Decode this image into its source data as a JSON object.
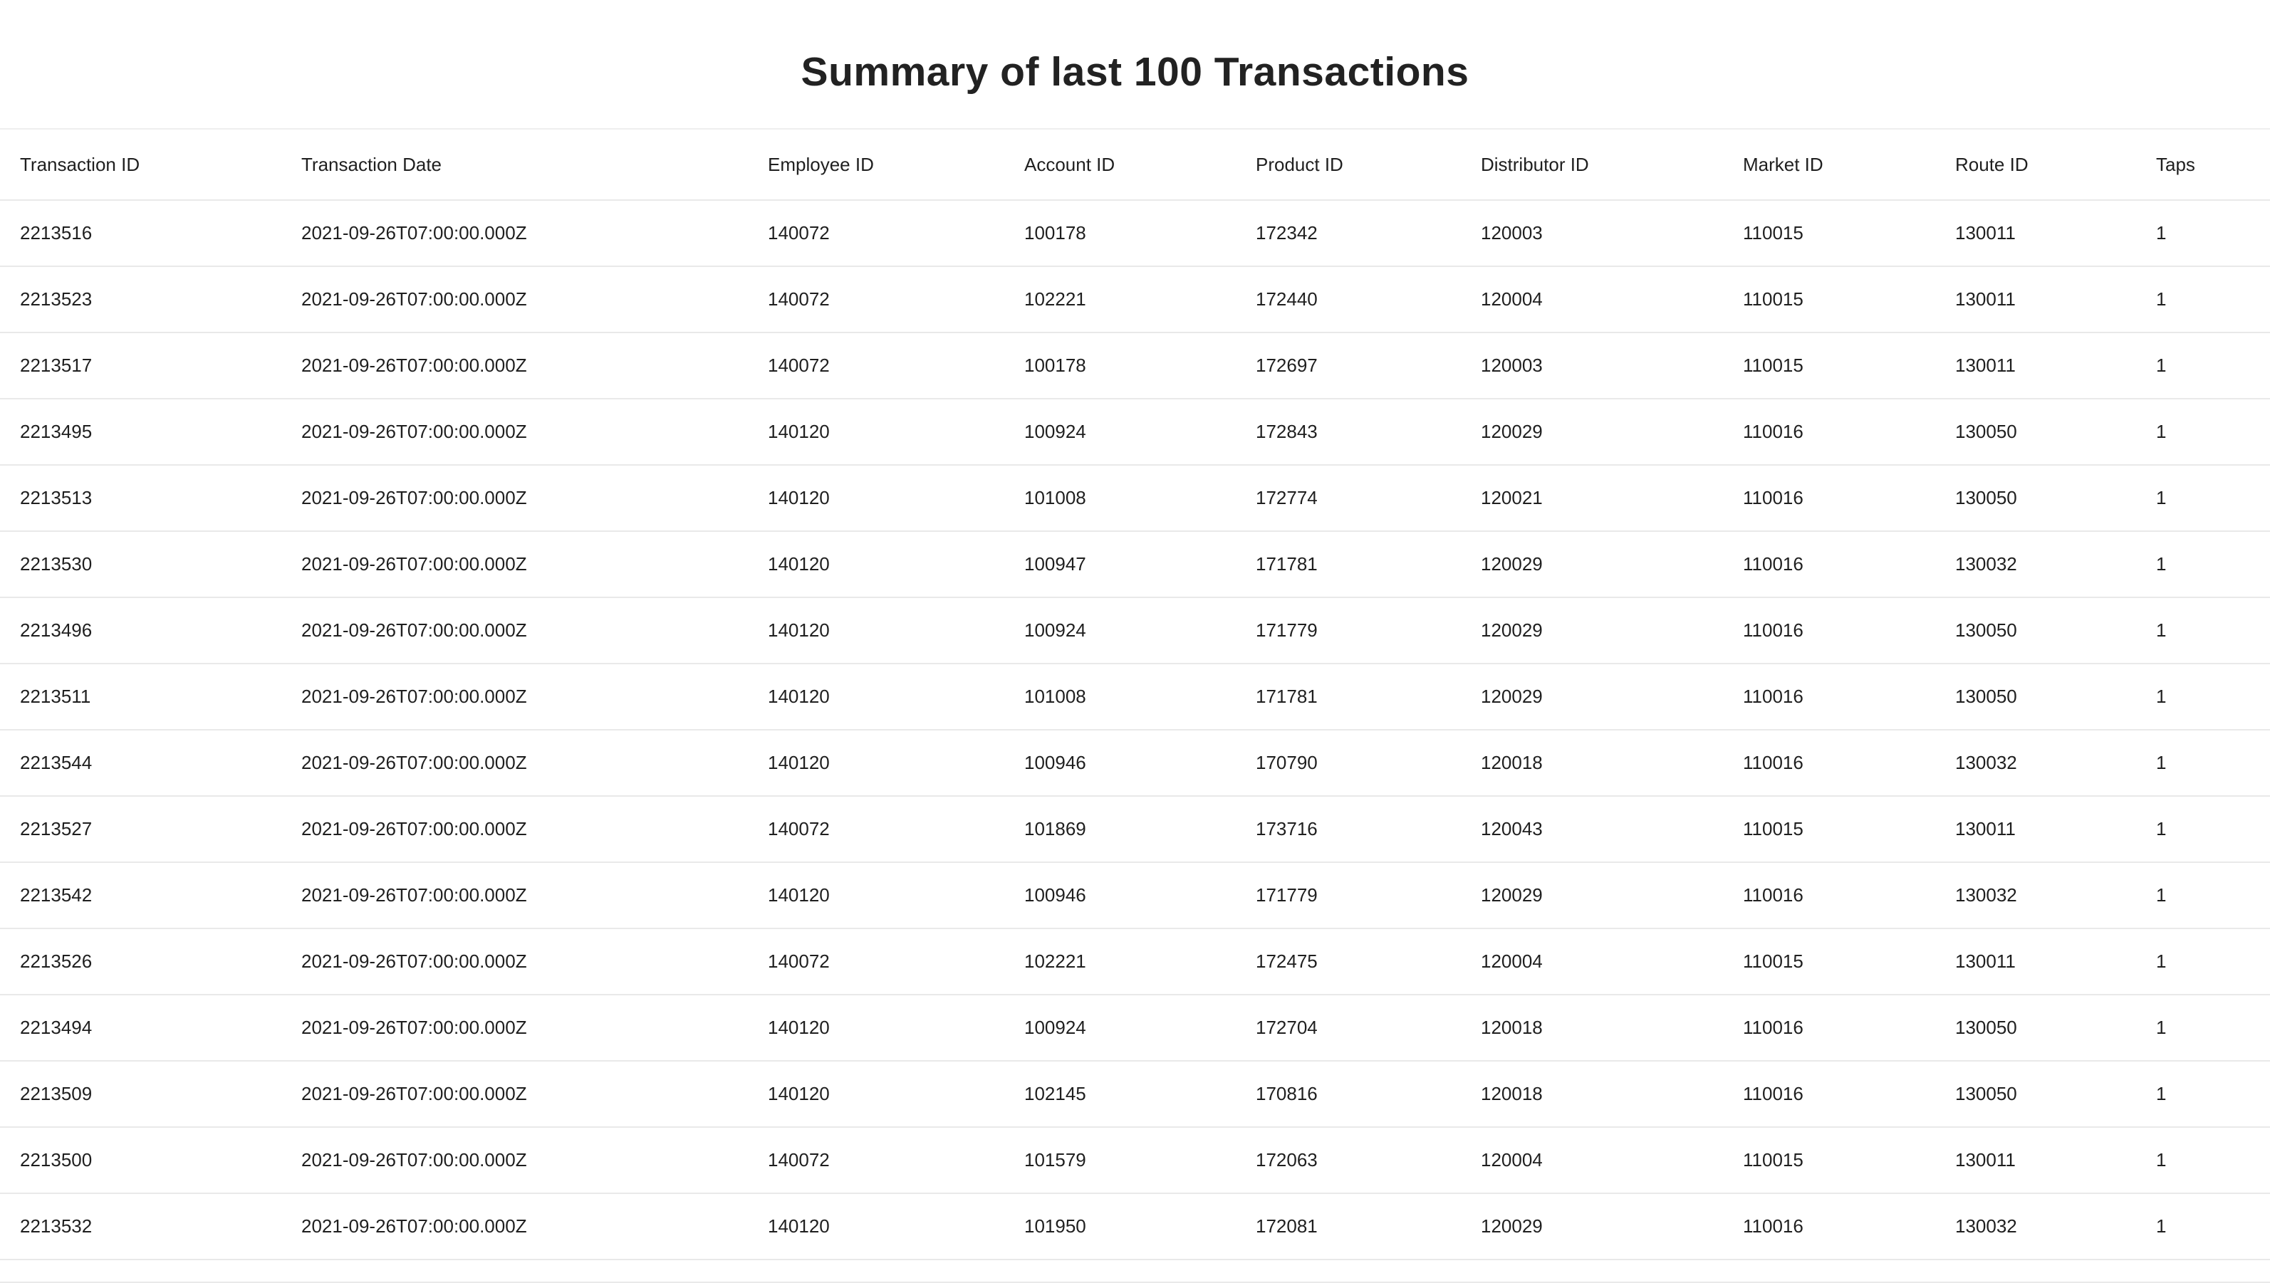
{
  "page": {
    "title": "Summary of last 100 Transactions"
  },
  "table": {
    "columns": [
      "Transaction ID",
      "Transaction Date",
      "Employee ID",
      "Account ID",
      "Product ID",
      "Distributor ID",
      "Market ID",
      "Route ID",
      "Taps"
    ],
    "rows": [
      [
        "2213516",
        "2021-09-26T07:00:00.000Z",
        "140072",
        "100178",
        "172342",
        "120003",
        "110015",
        "130011",
        "1"
      ],
      [
        "2213523",
        "2021-09-26T07:00:00.000Z",
        "140072",
        "102221",
        "172440",
        "120004",
        "110015",
        "130011",
        "1"
      ],
      [
        "2213517",
        "2021-09-26T07:00:00.000Z",
        "140072",
        "100178",
        "172697",
        "120003",
        "110015",
        "130011",
        "1"
      ],
      [
        "2213495",
        "2021-09-26T07:00:00.000Z",
        "140120",
        "100924",
        "172843",
        "120029",
        "110016",
        "130050",
        "1"
      ],
      [
        "2213513",
        "2021-09-26T07:00:00.000Z",
        "140120",
        "101008",
        "172774",
        "120021",
        "110016",
        "130050",
        "1"
      ],
      [
        "2213530",
        "2021-09-26T07:00:00.000Z",
        "140120",
        "100947",
        "171781",
        "120029",
        "110016",
        "130032",
        "1"
      ],
      [
        "2213496",
        "2021-09-26T07:00:00.000Z",
        "140120",
        "100924",
        "171779",
        "120029",
        "110016",
        "130050",
        "1"
      ],
      [
        "2213511",
        "2021-09-26T07:00:00.000Z",
        "140120",
        "101008",
        "171781",
        "120029",
        "110016",
        "130050",
        "1"
      ],
      [
        "2213544",
        "2021-09-26T07:00:00.000Z",
        "140120",
        "100946",
        "170790",
        "120018",
        "110016",
        "130032",
        "1"
      ],
      [
        "2213527",
        "2021-09-26T07:00:00.000Z",
        "140072",
        "101869",
        "173716",
        "120043",
        "110015",
        "130011",
        "1"
      ],
      [
        "2213542",
        "2021-09-26T07:00:00.000Z",
        "140120",
        "100946",
        "171779",
        "120029",
        "110016",
        "130032",
        "1"
      ],
      [
        "2213526",
        "2021-09-26T07:00:00.000Z",
        "140072",
        "102221",
        "172475",
        "120004",
        "110015",
        "130011",
        "1"
      ],
      [
        "2213494",
        "2021-09-26T07:00:00.000Z",
        "140120",
        "100924",
        "172704",
        "120018",
        "110016",
        "130050",
        "1"
      ],
      [
        "2213509",
        "2021-09-26T07:00:00.000Z",
        "140120",
        "102145",
        "170816",
        "120018",
        "110016",
        "130050",
        "1"
      ],
      [
        "2213500",
        "2021-09-26T07:00:00.000Z",
        "140072",
        "101579",
        "172063",
        "120004",
        "110015",
        "130011",
        "1"
      ],
      [
        "2213532",
        "2021-09-26T07:00:00.000Z",
        "140120",
        "101950",
        "172081",
        "120029",
        "110016",
        "130032",
        "1"
      ]
    ]
  }
}
